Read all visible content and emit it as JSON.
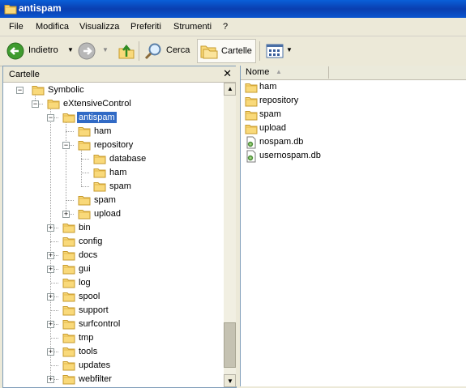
{
  "window": {
    "title": "antispam"
  },
  "menu": [
    "File",
    "Modifica",
    "Visualizza",
    "Preferiti",
    "Strumenti",
    "?"
  ],
  "toolbar": {
    "back_label": "Indietro",
    "search_label": "Cerca",
    "folders_label": "Cartelle"
  },
  "left_pane": {
    "title": "Cartelle",
    "close_glyph": "✕"
  },
  "tree": [
    {
      "label": "Symbolic",
      "expander": "⊟"
    },
    {
      "label": "eXtensiveControl",
      "expander": "⊟"
    },
    {
      "label": "antispam",
      "expander": "⊟",
      "selected": true
    },
    {
      "label": "ham",
      "expander": ""
    },
    {
      "label": "repository",
      "expander": "⊟"
    },
    {
      "label": "database",
      "expander": ""
    },
    {
      "label": "ham",
      "expander": ""
    },
    {
      "label": "spam",
      "expander": ""
    },
    {
      "label": "spam",
      "expander": ""
    },
    {
      "label": "upload",
      "expander": "⊞"
    },
    {
      "label": "bin",
      "expander": "⊞"
    },
    {
      "label": "config",
      "expander": ""
    },
    {
      "label": "docs",
      "expander": "⊞"
    },
    {
      "label": "gui",
      "expander": "⊞"
    },
    {
      "label": "log",
      "expander": ""
    },
    {
      "label": "spool",
      "expander": "⊞"
    },
    {
      "label": "support",
      "expander": ""
    },
    {
      "label": "surfcontrol",
      "expander": "⊞"
    },
    {
      "label": "tmp",
      "expander": ""
    },
    {
      "label": "tools",
      "expander": "⊞"
    },
    {
      "label": "updates",
      "expander": ""
    },
    {
      "label": "webfilter",
      "expander": "⊞"
    }
  ],
  "file_list": {
    "column_name": "Nome",
    "items": [
      {
        "name": "ham",
        "icon": "folder-icon"
      },
      {
        "name": "repository",
        "icon": "folder-icon"
      },
      {
        "name": "spam",
        "icon": "folder-icon"
      },
      {
        "name": "upload",
        "icon": "folder-icon"
      },
      {
        "name": "nospam.db",
        "icon": "db-file-icon"
      },
      {
        "name": "usernospam.db",
        "icon": "db-file-icon"
      }
    ]
  }
}
